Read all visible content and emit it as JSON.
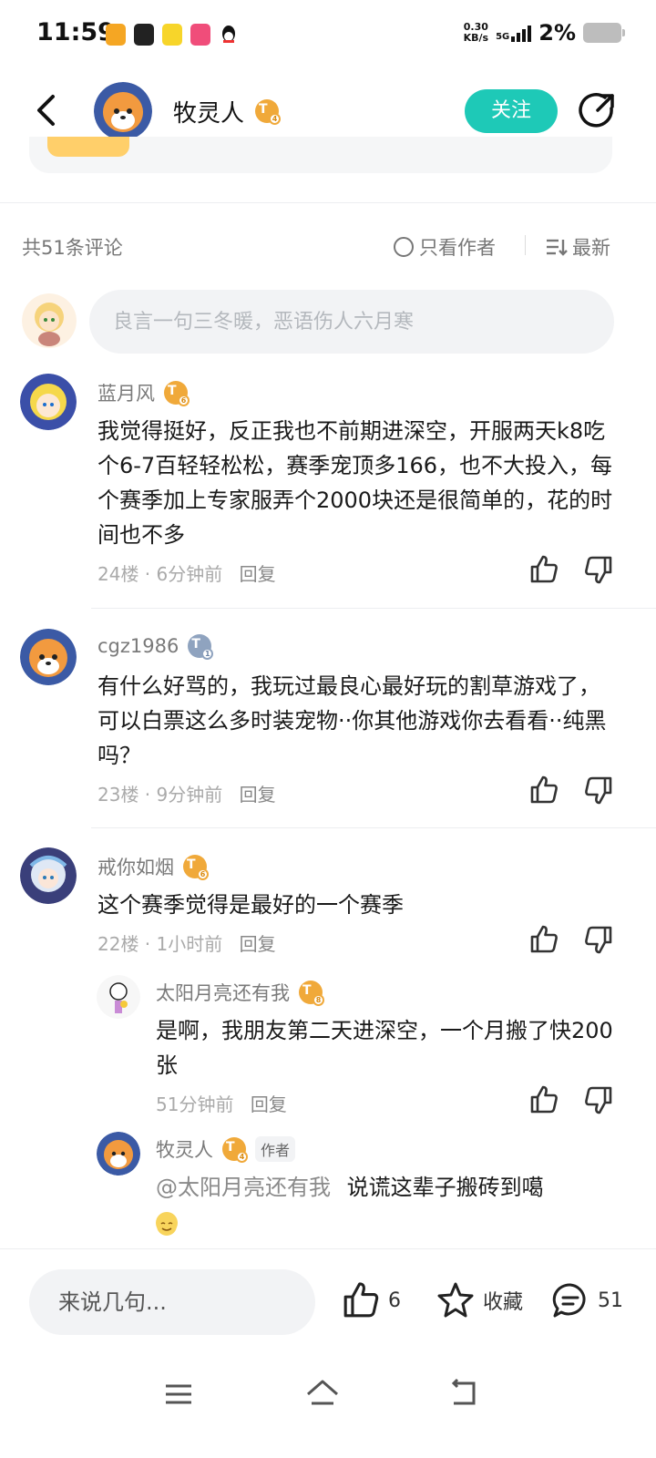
{
  "status_bar": {
    "time": "11:59",
    "net_speed_value": "0.30",
    "net_speed_unit": "KB/s",
    "network": "5G",
    "battery": "2%"
  },
  "header": {
    "author_name": "牧灵人",
    "author_level": "4",
    "follow_label": "关注"
  },
  "toolbar": {
    "count_label": "共51条评论",
    "only_author_label": "只看作者",
    "sort_label": "最新"
  },
  "comment_input": {
    "placeholder": "良言一句三冬暖，恶语伤人六月寒"
  },
  "comments": [
    {
      "name": "蓝月风",
      "level": "6",
      "text": "我觉得挺好，反正我也不前期进深空，开服两天k8吃个6-7百轻轻松松，赛季宠顶多166，也不大投入，每个赛季加上专家服弄个2000块还是很简单的，花的时间也不多",
      "meta": "24楼 · 6分钟前",
      "reply_label": "回复"
    },
    {
      "name": "cgz1986",
      "level": "1",
      "text": "有什么好骂的，我玩过最良心最好玩的割草游戏了，可以白票这么多时装宠物··你其他游戏你去看看··纯黑吗？",
      "meta": "23楼 · 9分钟前",
      "reply_label": "回复"
    },
    {
      "name": "戒你如烟",
      "level": "6",
      "text": "这个赛季觉得是最好的一个赛季",
      "meta": "22楼 · 1小时前",
      "reply_label": "回复",
      "replies": [
        {
          "name": "太阳月亮还有我",
          "level": "8",
          "text": "是啊，我朋友第二天进深空，一个月搬了快200张",
          "meta": "51分钟前",
          "reply_label": "回复"
        },
        {
          "name": "牧灵人",
          "level": "4",
          "author_tag": "作者",
          "at_user": "@太阳月亮还有我",
          "text": "说谎这辈子搬砖到噶"
        }
      ]
    }
  ],
  "bottom_bar": {
    "input_label": "来说几句...",
    "like_count": "6",
    "favorite_label": "收藏",
    "comment_count": "51"
  },
  "colors": {
    "accent": "#1ec9b7",
    "level_badge": "#f0a93a",
    "level_badge_low": "#8fa3bf"
  }
}
